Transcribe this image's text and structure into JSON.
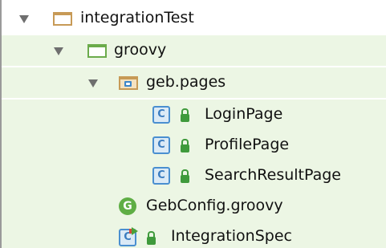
{
  "project_tree": {
    "items": [
      {
        "label": "integrationTest",
        "icon": "folder-icon",
        "expanded": true
      },
      {
        "label": "groovy",
        "icon": "source-folder-icon",
        "expanded": true
      },
      {
        "label": "geb.pages",
        "icon": "package-icon",
        "expanded": true
      },
      {
        "label": "LoginPage",
        "icon": "class-icon",
        "badge": "lock-icon"
      },
      {
        "label": "ProfilePage",
        "icon": "class-icon",
        "badge": "lock-icon"
      },
      {
        "label": "SearchResultPage",
        "icon": "class-icon",
        "badge": "lock-icon"
      },
      {
        "label": "GebConfig.groovy",
        "icon": "groovy-file-icon"
      },
      {
        "label": "IntegrationSpec",
        "icon": "test-class-icon",
        "badge": "lock-icon"
      }
    ],
    "icon_letters": {
      "class": "C",
      "groovy": "G"
    },
    "colors": {
      "highlight": "#ecf6e4",
      "folder": "#c79a56",
      "source_folder": "#6bab4b",
      "class_icon": "#4a8fd0",
      "lock": "#3f9a3c"
    }
  }
}
